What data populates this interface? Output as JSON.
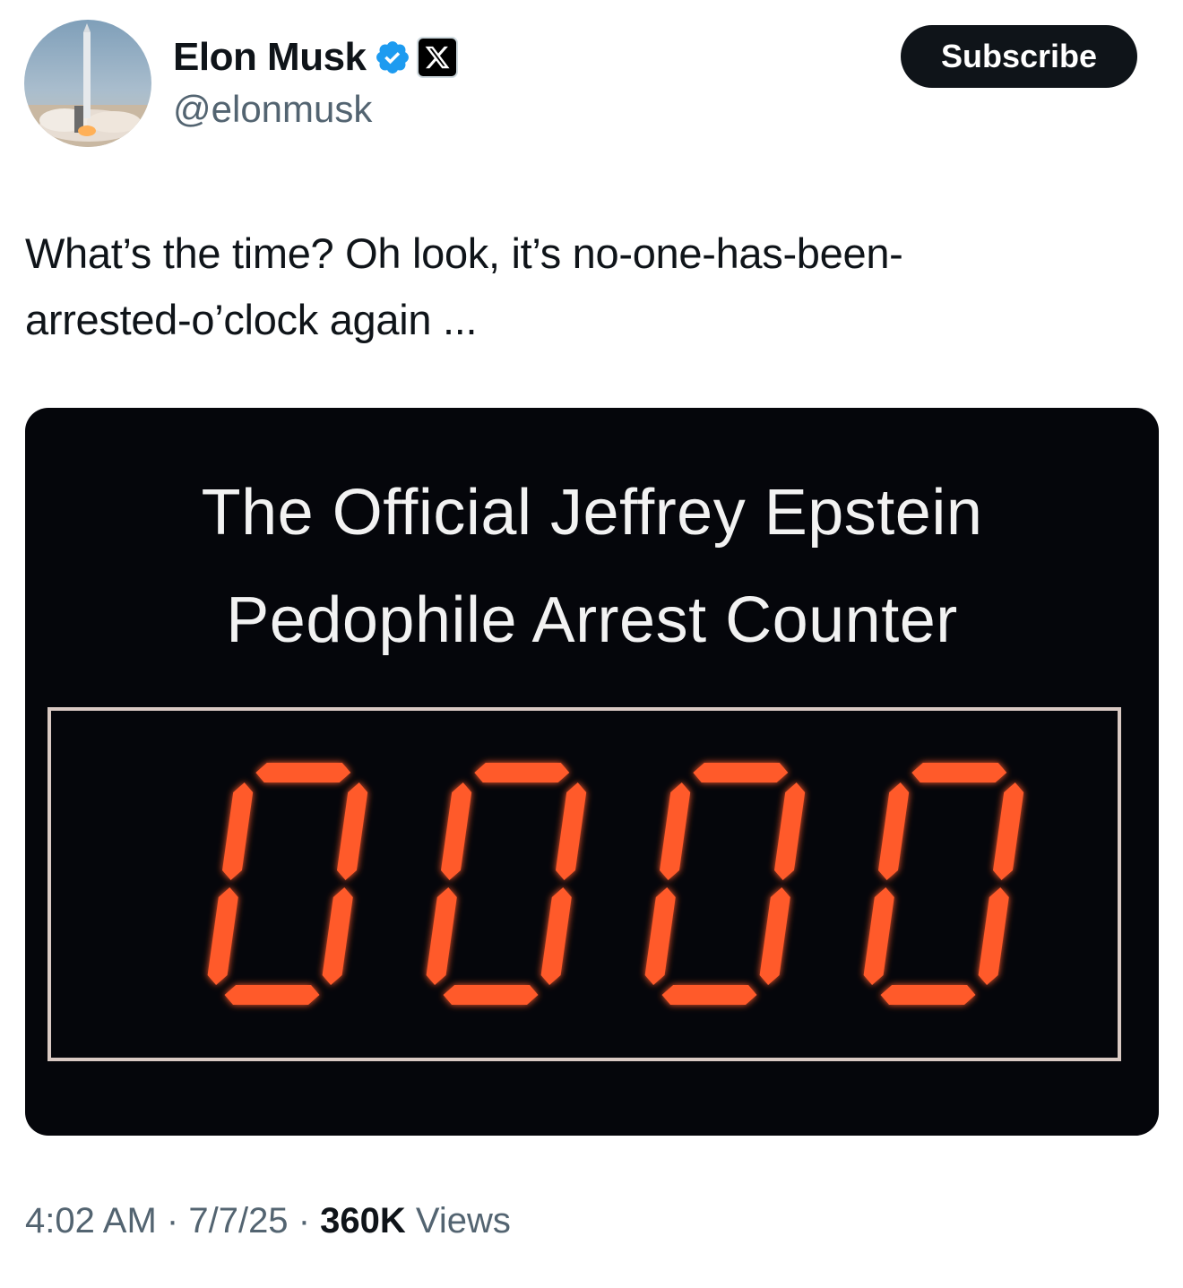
{
  "author": {
    "display_name": "Elon Musk",
    "handle": "@elonmusk",
    "verified_icon": "verified-badge-icon",
    "affiliation_icon": "x-logo-icon",
    "avatar_icon": "rocket-launch-avatar"
  },
  "subscribe": {
    "label": "Subscribe"
  },
  "tweet": {
    "line1": "What’s the time? Oh look, it’s no-one-has-been-",
    "line2": "arrested-o’clock again ..."
  },
  "media": {
    "title_line1": "The Official Jeffrey Epstein",
    "title_line2": "Pedophile Arrest Counter",
    "counter_value": "0000",
    "digit_color": "#ff5a2a"
  },
  "meta": {
    "time": "4:02 AM",
    "date": "7/7/25",
    "separator": "·",
    "views_count": "360K",
    "views_label": "Views"
  },
  "colors": {
    "text_primary": "#0f1419",
    "text_secondary": "#536471",
    "verified_blue": "#1d9bf0"
  }
}
